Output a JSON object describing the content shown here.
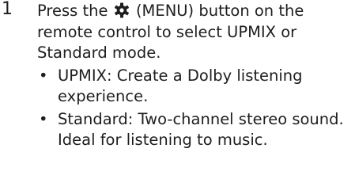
{
  "step": {
    "number": "1",
    "instruction_before": "Press the",
    "icon": "gear-icon",
    "instruction_after": "(MENU) button on the remote control to select UPMIX or Standard mode."
  },
  "options": [
    {
      "bullet": "•",
      "text": "UPMIX: Create a Dolby listening experience."
    },
    {
      "bullet": "•",
      "text": "Standard: Two-channel stereo sound. Ideal for listening to music."
    }
  ]
}
